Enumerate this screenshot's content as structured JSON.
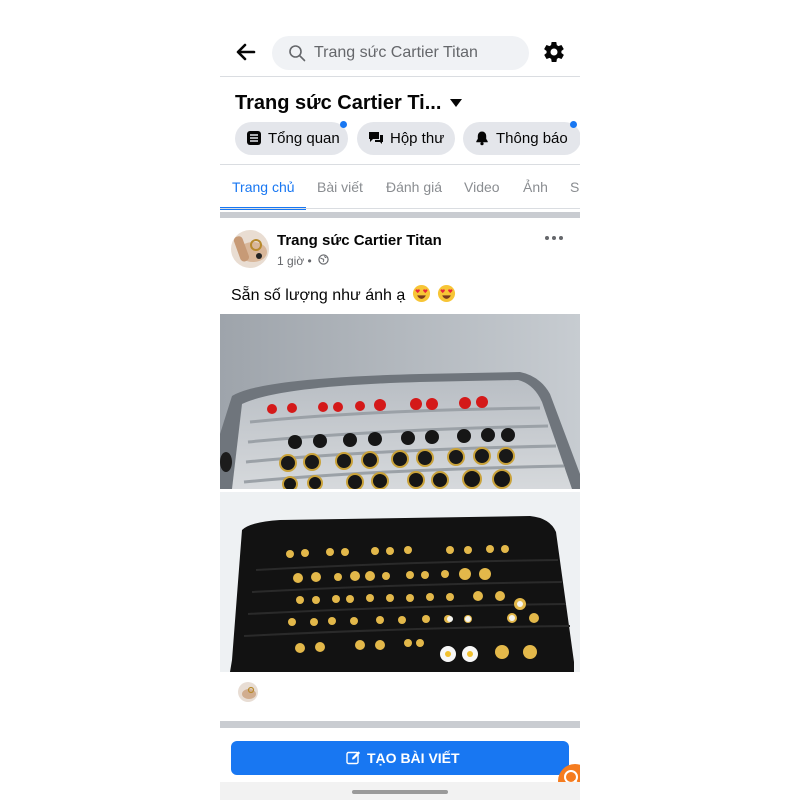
{
  "search": {
    "placeholder": "Trang sức Cartier Titan"
  },
  "page": {
    "title": "Trang sức Cartier Ti..."
  },
  "chips": [
    {
      "label": "Tổng quan",
      "icon": "list-icon",
      "has_dot": true
    },
    {
      "label": "Hộp thư",
      "icon": "chat-icon",
      "has_dot": false
    },
    {
      "label": "Thông báo",
      "icon": "bell-icon",
      "has_dot": true
    }
  ],
  "tabs": [
    {
      "label": "Trang chủ",
      "active": true
    },
    {
      "label": "Bài viết",
      "active": false
    },
    {
      "label": "Đánh giá",
      "active": false
    },
    {
      "label": "Video",
      "active": false
    },
    {
      "label": "Ảnh",
      "active": false
    },
    {
      "label": "S",
      "active": false
    }
  ],
  "post": {
    "author": "Trang sức Cartier Titan",
    "time": "1 giờ •",
    "text": "Sẵn số lượng như ánh ạ",
    "emoji": "heart-eyes-emoji"
  },
  "create_post": {
    "label": "TẠO BÀI VIẾT"
  },
  "colors": {
    "accent": "#1877f2",
    "divider": "#dadde1",
    "fab": "#f57c1f"
  }
}
